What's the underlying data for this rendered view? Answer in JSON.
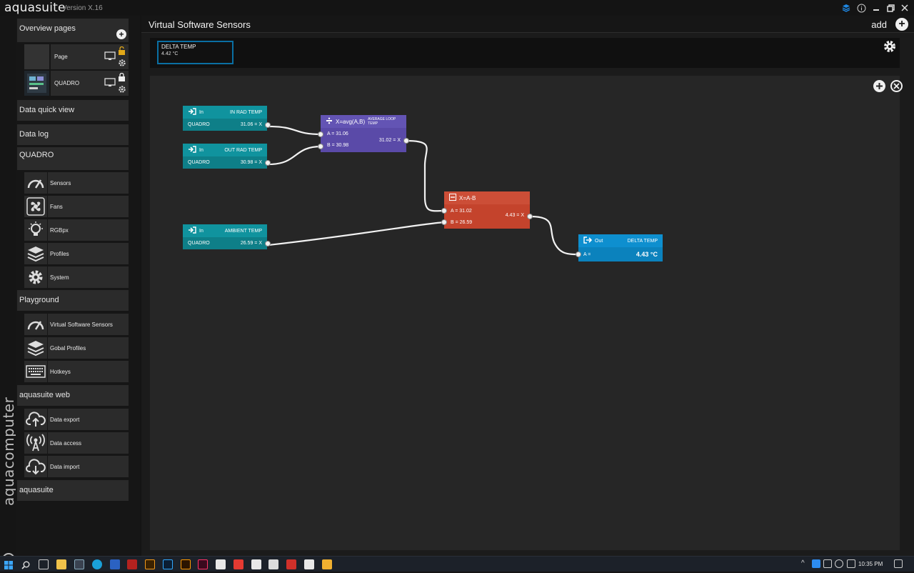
{
  "app": {
    "name": "aquasuite",
    "version": "Version X.16",
    "brand": "aquacomputer"
  },
  "sidebar": {
    "overview": {
      "title": "Overview pages"
    },
    "pages": [
      {
        "label": "Page"
      },
      {
        "label": "QUADRO"
      }
    ],
    "data_quick_view": "Data quick view",
    "data_log": "Data log",
    "quadro": {
      "title": "QUADRO",
      "items": [
        {
          "label": "Sensors",
          "icon": "gauge-icon"
        },
        {
          "label": "Fans",
          "icon": "fan-icon"
        },
        {
          "label": "RGBpx",
          "icon": "lightbulb-icon"
        },
        {
          "label": "Profiles",
          "icon": "layers-icon"
        },
        {
          "label": "System",
          "icon": "gear-icon"
        }
      ]
    },
    "playground": {
      "title": "Playground",
      "items": [
        {
          "label": "Virtual Software Sensors",
          "icon": "gauge-icon"
        },
        {
          "label": "Gobal Profiles",
          "icon": "layers-icon"
        },
        {
          "label": "Hotkeys",
          "icon": "keyboard-icon"
        }
      ]
    },
    "web": {
      "title": "aquasuite web",
      "items": [
        {
          "label": "Data export",
          "icon": "cloud-upload-icon"
        },
        {
          "label": "Data access",
          "icon": "broadcast-icon"
        },
        {
          "label": "Data import",
          "icon": "cloud-download-icon"
        }
      ]
    },
    "aquasuite": "aquasuite"
  },
  "main": {
    "title": "Virtual Software Sensors",
    "add_label": "add",
    "tile": {
      "name": "DELTA TEMP",
      "value": "4.42 °C"
    }
  },
  "nodes": {
    "in1": {
      "kind": "In",
      "name": "IN RAD TEMP",
      "source": "QUADRO",
      "value": "31.06 = X"
    },
    "in2": {
      "kind": "In",
      "name": "OUT RAD TEMP",
      "source": "QUADRO",
      "value": "30.98 = X"
    },
    "in3": {
      "kind": "In",
      "name": "AMBIENT TEMP",
      "source": "QUADRO",
      "value": "26.59 = X"
    },
    "avg": {
      "formula": "X=avg(A,B)",
      "name": "AVERAGE LOOP TEMP",
      "a": "A = 31.06",
      "b": "B = 30.98",
      "out": "31.02 = X"
    },
    "sub": {
      "formula": "X=A-B",
      "a": "A = 31.02",
      "b": "B = 26.59",
      "out": "4.43 = X"
    },
    "out": {
      "kind": "Out",
      "name": "DELTA TEMP",
      "a": "A =",
      "value": "4.43 °C"
    }
  },
  "taskbar": {
    "time": "10:35 PM"
  },
  "colors": {
    "input_node": "#10939e",
    "avg_node": "#5a4aa8",
    "sub_node": "#c4432c",
    "out_node": "#0b82bd",
    "tile_border": "#0a6fa3"
  }
}
